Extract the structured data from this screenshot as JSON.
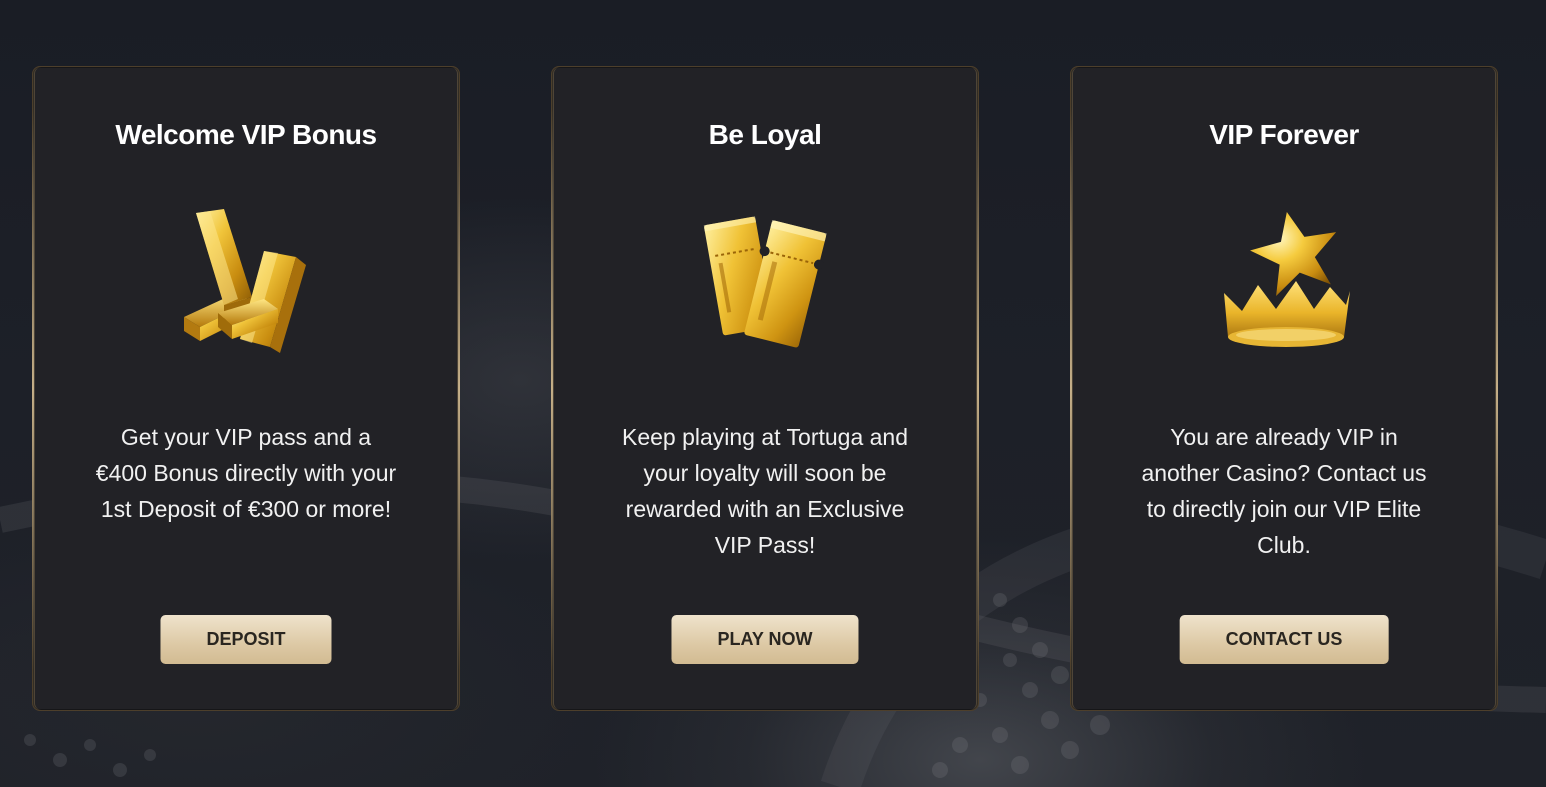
{
  "cards": [
    {
      "title": "Welcome VIP Bonus",
      "icon": "gold-bars-icon",
      "text": "Get your VIP pass and a €400 Bonus directly with your 1st Deposit of €300 or more!",
      "button_label": "DEPOSIT"
    },
    {
      "title": "Be Loyal",
      "icon": "golden-tickets-icon",
      "text": "Keep playing at Tortuga and your loyalty will soon be rewarded with an Exclusive VIP Pass!",
      "button_label": "PLAY NOW"
    },
    {
      "title": "VIP Forever",
      "icon": "star-crown-icon",
      "text": "You are already VIP in another Casino? Contact us to directly join our VIP Elite Club.",
      "button_label": "CONTACT US"
    }
  ],
  "colors": {
    "background": "#1b1e26",
    "card": "#222226",
    "card_border": "#4d3f2b",
    "gold": "#e6b422",
    "button": "#e3d2b0",
    "button_text": "#2a2620"
  }
}
